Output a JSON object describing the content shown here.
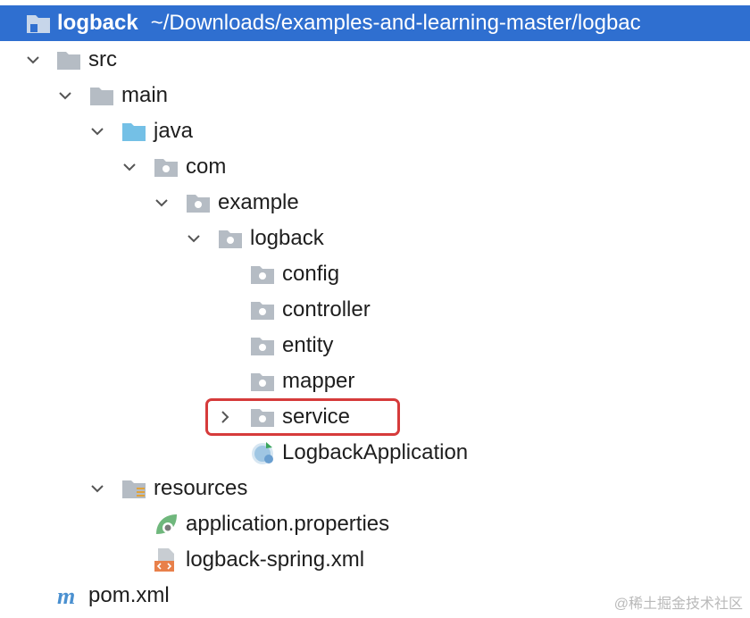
{
  "root": {
    "label": "logback",
    "path": "~/Downloads/examples-and-learning-master/logbac"
  },
  "tree": {
    "src": "src",
    "main": "main",
    "java": "java",
    "com": "com",
    "example": "example",
    "logback": "logback",
    "config": "config",
    "controller": "controller",
    "entity": "entity",
    "mapper": "mapper",
    "service": "service",
    "logback_application": "LogbackApplication",
    "resources": "resources",
    "application_properties": "application.properties",
    "logback_spring_xml": "logback-spring.xml",
    "pom_xml": "pom.xml"
  },
  "colors": {
    "selection": "#2f6fd0",
    "highlight_border": "#d63b3b",
    "folder_gray": "#b5bcc4",
    "source_blue": "#74c0e6"
  },
  "watermark": "@稀土掘金技术社区"
}
